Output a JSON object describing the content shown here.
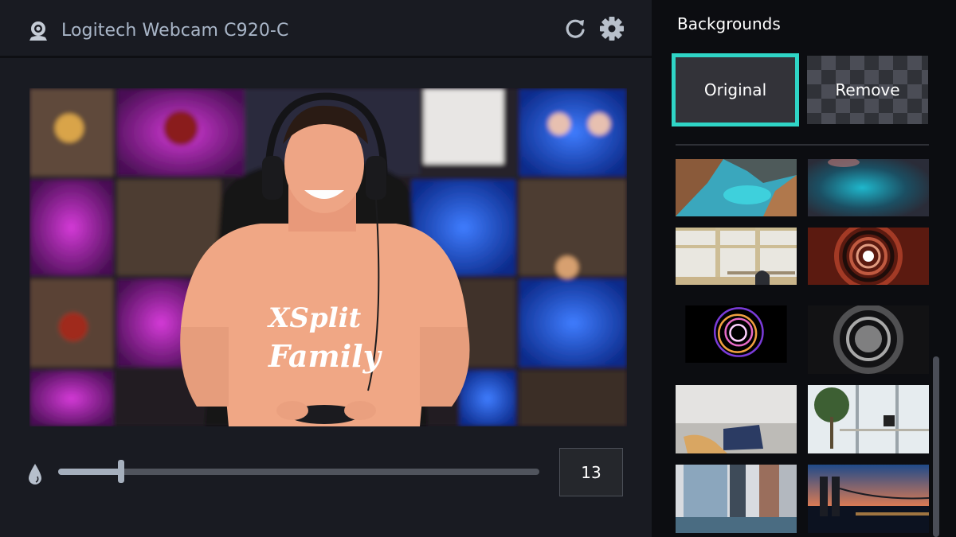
{
  "header": {
    "camera_icon": "webcam-icon",
    "title": "Logitech Webcam C920-C",
    "refresh_icon": "refresh-icon",
    "settings_icon": "gear-icon"
  },
  "preview": {
    "description": "Live webcam feed: smiling man in peach XSplit Family t-shirt wearing headphones, holding a game controller, shelves with figurines and blue/magenta lighting behind",
    "shirt_text": "XSplit Family"
  },
  "blur": {
    "icon": "droplet-icon",
    "value": 13,
    "value_text": "13",
    "min": 0,
    "max": 100
  },
  "backgrounds": {
    "title": "Backgrounds",
    "options": [
      {
        "label": "Original",
        "selected": true
      },
      {
        "label": "Remove",
        "selected": false
      }
    ],
    "thumbnails": [
      {
        "name": "coastal-cove",
        "description": "Rocky coastal cove with turquoise water"
      },
      {
        "name": "teal-blur",
        "description": "Blurry teal bokeh light"
      },
      {
        "name": "window-office",
        "description": "Bright room with windows, desk and chair"
      },
      {
        "name": "red-tunnel",
        "description": "Red circular tunnel with light at center"
      },
      {
        "name": "light-spiral",
        "description": "Colorful light-painting spiral on black"
      },
      {
        "name": "grey-spiral-stairs",
        "description": "Greyscale spiral staircase from above"
      },
      {
        "name": "sofa-guitar",
        "description": "Sofa with guitar and cushions"
      },
      {
        "name": "office-plant",
        "description": "Office with palm plant and laptop by windows"
      },
      {
        "name": "city-buildings",
        "description": "City skyscrapers seen through window"
      },
      {
        "name": "bridge-night",
        "description": "Bridge and city skyline at dusk"
      }
    ]
  },
  "colors": {
    "accent": "#2fd5c6",
    "panel_bg": "#191b22",
    "sidebar_bg": "#0c0d11"
  }
}
